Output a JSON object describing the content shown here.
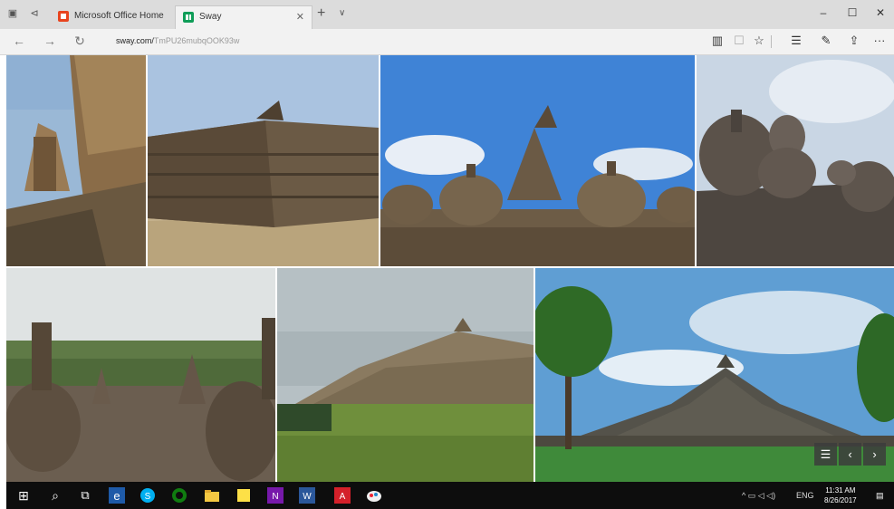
{
  "browser": {
    "tabs": [
      {
        "label": "Microsoft Office Home",
        "favicon": "office-icon",
        "color": "#e8441e"
      },
      {
        "label": "Sway",
        "favicon": "sway-icon",
        "color": "#0f9d58"
      }
    ],
    "url_host": "sway.com/",
    "url_path": "TmPU26mubqOOK93w"
  },
  "icons": {
    "tab_restore": "▣",
    "tab_back": "⊲",
    "close": "✕",
    "new_tab": "+",
    "tab_list": "∨",
    "minimize": "–",
    "maximize": "☐",
    "win_close": "✕",
    "back": "←",
    "forward": "→",
    "refresh": "↻",
    "reading_view": "▥",
    "favorites": "☆",
    "hub": "☰",
    "notes": "✎",
    "share": "⇪",
    "more": "···",
    "slide_list": "☰",
    "prev": "‹",
    "next": "›",
    "start": "⊞",
    "search": "⌕",
    "task_view": "⧉"
  },
  "taskbar": {
    "apps": [
      "edge",
      "skype",
      "xbox",
      "file-explorer",
      "sticky-notes",
      "onenote",
      "word",
      "acrobat",
      "paint"
    ],
    "tray": "ENG",
    "time": "11:31 AM",
    "date": "8/26/2017"
  }
}
